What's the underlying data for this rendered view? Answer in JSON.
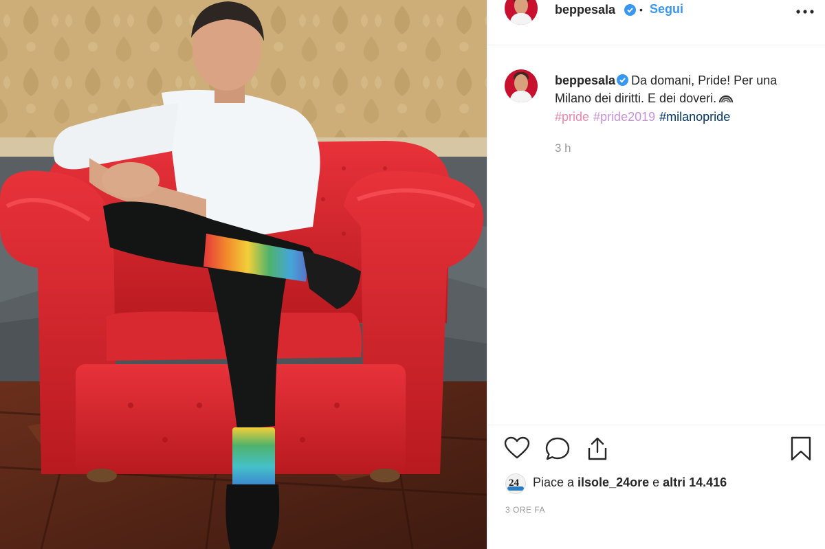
{
  "post": {
    "username": "beppesala",
    "verified": true,
    "separator": "•",
    "follow_label": "Segui",
    "more_icon": "more-horizontal-icon"
  },
  "caption": {
    "username": "beppesala",
    "text": "Da domani, Pride! Per una Milano dei diritti. E dei doveri.",
    "emoji": "rainbow-icon",
    "hashtags": [
      {
        "tag": "#pride",
        "color": "#e887a8"
      },
      {
        "tag": "#pride2019",
        "color": "#c893d6"
      },
      {
        "tag": "#milanopride",
        "color": "#003569"
      }
    ],
    "time": "3 h"
  },
  "actions": {
    "like_icon": "heart-icon",
    "comment_icon": "comment-icon",
    "share_icon": "share-icon",
    "save_icon": "bookmark-icon"
  },
  "likes": {
    "prefix": "Piace a ",
    "first_user": "ilsole_24ore",
    "middle": " e ",
    "others": "altri 14.416",
    "avatar_label": "24"
  },
  "post_date": "3 ORE FA",
  "colors": {
    "accent": "#3897f0",
    "text": "#262626",
    "muted": "#999999",
    "chair": "#d9232b",
    "wallpaper": "#c9a873"
  }
}
